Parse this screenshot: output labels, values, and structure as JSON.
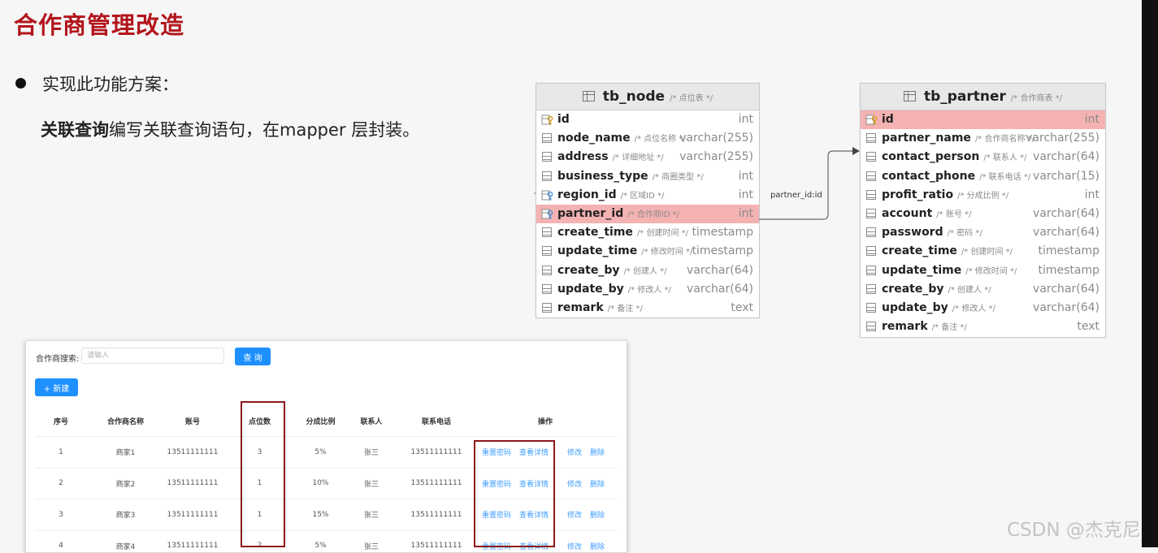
{
  "slide": {
    "title": "合作商管理改造",
    "bullet": "实现此功能方案：",
    "line2_bold": "关联查询",
    "line2_rest": "编写关联查询语句，在mapper 层封装。"
  },
  "tb_node": {
    "name": "tb_node",
    "comment": "/* 点位表 */",
    "columns": [
      {
        "name": "id",
        "comment": "",
        "type": "int",
        "key": "pk"
      },
      {
        "name": "node_name",
        "comment": "/* 点位名称 */",
        "type": "varchar(255)",
        "key": ""
      },
      {
        "name": "address",
        "comment": "/* 详细地址 */",
        "type": "varchar(255)",
        "key": ""
      },
      {
        "name": "business_type",
        "comment": "/* 商圈类型 */",
        "type": "int",
        "key": ""
      },
      {
        "name": "region_id",
        "comment": "/* 区域ID */",
        "type": "int",
        "key": "fk"
      },
      {
        "name": "partner_id",
        "comment": "/* 合作商ID */",
        "type": "int",
        "key": "fk"
      },
      {
        "name": "create_time",
        "comment": "/* 创建时间 */",
        "type": "timestamp",
        "key": ""
      },
      {
        "name": "update_time",
        "comment": "/* 修改时间 */",
        "type": "timestamp",
        "key": ""
      },
      {
        "name": "create_by",
        "comment": "/* 创建人 */",
        "type": "varchar(64)",
        "key": ""
      },
      {
        "name": "update_by",
        "comment": "/* 修改人 */",
        "type": "varchar(64)",
        "key": ""
      },
      {
        "name": "remark",
        "comment": "/* 备注 */",
        "type": "text",
        "key": ""
      }
    ]
  },
  "tb_partner": {
    "name": "tb_partner",
    "comment": "/* 合作商表 */",
    "columns": [
      {
        "name": "id",
        "comment": "",
        "type": "int",
        "key": "pk"
      },
      {
        "name": "partner_name",
        "comment": "/* 合作商名称 */",
        "type": "varchar(255)",
        "key": ""
      },
      {
        "name": "contact_person",
        "comment": "/* 联系人 */",
        "type": "varchar(64)",
        "key": ""
      },
      {
        "name": "contact_phone",
        "comment": "/* 联系电话 */",
        "type": "varchar(15)",
        "key": ""
      },
      {
        "name": "profit_ratio",
        "comment": "/* 分成比例 */",
        "type": "int",
        "key": ""
      },
      {
        "name": "account",
        "comment": "/* 账号 */",
        "type": "varchar(64)",
        "key": ""
      },
      {
        "name": "password",
        "comment": "/* 密码 */",
        "type": "varchar(64)",
        "key": ""
      },
      {
        "name": "create_time",
        "comment": "/* 创建时间 */",
        "type": "timestamp",
        "key": ""
      },
      {
        "name": "update_time",
        "comment": "/* 修改时间 */",
        "type": "timestamp",
        "key": ""
      },
      {
        "name": "create_by",
        "comment": "/* 创建人 */",
        "type": "varchar(64)",
        "key": ""
      },
      {
        "name": "update_by",
        "comment": "/* 修改人 */",
        "type": "varchar(64)",
        "key": ""
      },
      {
        "name": "remark",
        "comment": "/* 备注 */",
        "type": "text",
        "key": ""
      }
    ]
  },
  "relation_label": "partner_id:id",
  "app": {
    "search_label": "合作商搜索:",
    "search_placeholder": "请输入",
    "query_btn": "查 询",
    "new_btn": "+ 新建",
    "headers": [
      "序号",
      "合作商名称",
      "账号",
      "点位数",
      "分成比例",
      "联系人",
      "联系电话",
      "操作"
    ],
    "rows": [
      [
        "1",
        "商家1",
        "13511111111",
        "3",
        "5%",
        "张三",
        "13511111111"
      ],
      [
        "2",
        "商家2",
        "13511111111",
        "1",
        "10%",
        "张三",
        "13511111111"
      ],
      [
        "3",
        "商家3",
        "13511111111",
        "1",
        "15%",
        "张三",
        "13511111111"
      ],
      [
        "4",
        "商家4",
        "13511111111",
        "2",
        "5%",
        "张三",
        "13511111111"
      ]
    ],
    "ops": [
      "重置密码",
      "查看详情",
      "修改",
      "删除"
    ]
  },
  "watermark": "CSDN @杰克尼",
  "colors": {
    "title": "#b3151c",
    "highlight": "#f5b2b2",
    "primary": "#1e90ff",
    "redbox": "#8b1a1a"
  }
}
